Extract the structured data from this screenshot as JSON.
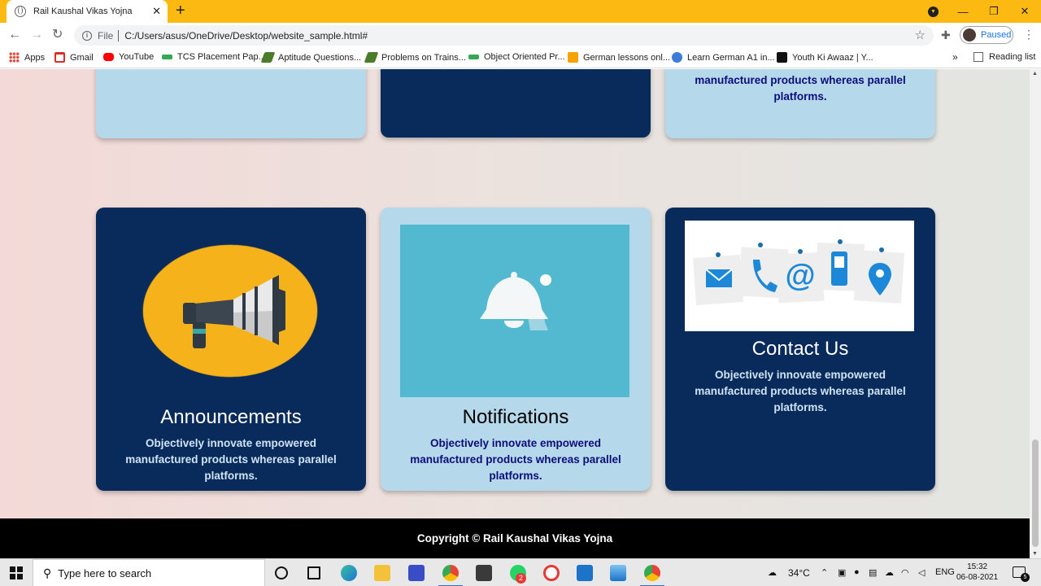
{
  "browser": {
    "tab_title": "Rail Kaushal Vikas Yojna",
    "tab_close": "✕",
    "new_tab": "+",
    "scheme": "File",
    "url": "C:/Users/asus/OneDrive/Desktop/website_sample.html#",
    "profile_status": "Paused",
    "window_controls": {
      "minimize": "—",
      "restore": "❐",
      "close": "✕"
    },
    "bookmarks": [
      {
        "label": "Apps",
        "icon": "apps-grid-icon",
        "color": "#e8453c"
      },
      {
        "label": "Gmail",
        "icon": "gmail-icon",
        "color": "#d93025"
      },
      {
        "label": "YouTube",
        "icon": "youtube-icon",
        "color": "#ff0000"
      },
      {
        "label": "TCS Placement Pap...",
        "icon": "site-icon",
        "color": "#34a853"
      },
      {
        "label": "Aptitude Questions...",
        "icon": "site-icon",
        "color": "#4a7c2a"
      },
      {
        "label": "Problems on Trains...",
        "icon": "site-icon",
        "color": "#4a7c2a"
      },
      {
        "label": "Object Oriented Pr...",
        "icon": "site-icon",
        "color": "#34a853"
      },
      {
        "label": "German lessons onl...",
        "icon": "site-icon",
        "color": "#f4a300"
      },
      {
        "label": "Learn German A1 in...",
        "icon": "site-icon",
        "color": "#3b7dd8"
      },
      {
        "label": "Youth Ki Awaaz | Y...",
        "icon": "site-icon",
        "color": "#111111"
      }
    ],
    "bookmarks_more": "»",
    "reading_list": "Reading list"
  },
  "page": {
    "cards_top": [
      {
        "theme": "light",
        "text": ""
      },
      {
        "theme": "dark",
        "text": ""
      },
      {
        "theme": "light",
        "text": "manufactured products whereas parallel platforms."
      }
    ],
    "cards": [
      {
        "title": "Announcements",
        "text": "Objectively innovate empowered manufactured products whereas parallel platforms.",
        "theme": "dark",
        "image": "megaphone-icon"
      },
      {
        "title": "Notifications",
        "text": "Objectively innovate empowered manufactured products whereas parallel platforms.",
        "theme": "light",
        "image": "bell-icon"
      },
      {
        "title": "Contact Us",
        "text": "Objectively innovate empowered manufactured products whereas parallel platforms.",
        "theme": "dark",
        "image": "contact-icons"
      }
    ],
    "footer": "Copyright © Rail Kaushal Vikas Yojna"
  },
  "taskbar": {
    "search_placeholder": "Type here to search",
    "temperature": "34°C",
    "language": "ENG",
    "time": "15:32",
    "date": "06-08-2021",
    "notification_count": "5",
    "whatsapp_badge": "2"
  },
  "colors": {
    "tabstrip": "#fcb912",
    "card_dark": "#092b5c",
    "card_light": "#b5d8eb",
    "footer": "#000000"
  }
}
